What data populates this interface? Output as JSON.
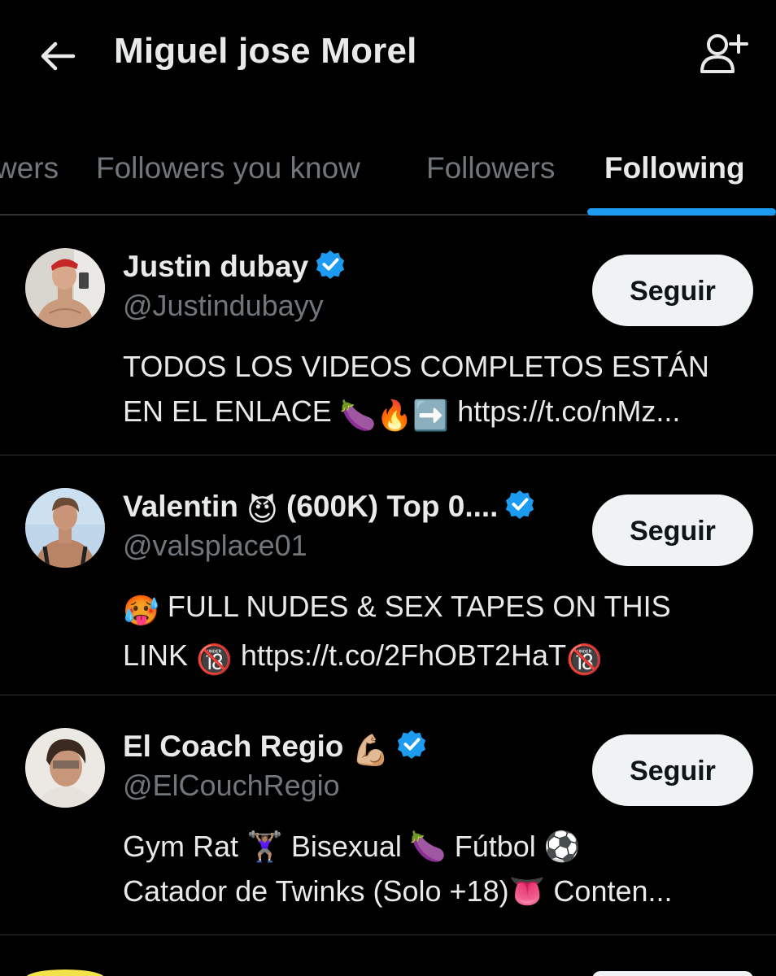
{
  "header": {
    "title": "Miguel jose Morel"
  },
  "tabs": [
    {
      "label": "wers"
    },
    {
      "label": "Followers you know"
    },
    {
      "label": "Followers"
    },
    {
      "label": "Following",
      "active": true
    }
  ],
  "accounts": [
    {
      "name": "Justin dubay",
      "handle": "@Justindubayy",
      "verified": true,
      "button": "Seguir",
      "bio_line1": "TODOS LOS VIDEOS COMPLETOS ESTÁN",
      "bio_line2_text": "EN EL ENLACE",
      "bio_line2_emoji": "🍆🔥➡️",
      "bio_line2_link": "https://t.co/nMz..."
    },
    {
      "name": "Valentin",
      "name_emoji": "😈",
      "name_rest": "(600K) Top 0....",
      "handle": "@valsplace01",
      "verified": true,
      "button": "Seguir",
      "bio_line1_emoji": "🥵",
      "bio_line1": "FULL NUDES & SEX TAPES ON THIS",
      "bio_line2_text": "LINK",
      "bio_line2_emoji": "🔞",
      "bio_line2_link": "https://t.co/2FhOBT2HaT",
      "bio_line2_emoji_end": "🔞"
    },
    {
      "name": "El Coach Regio",
      "name_emoji": "💪🏼",
      "handle": "@ElCouchRegio",
      "verified": true,
      "button": "Seguir",
      "bio_line1": "Gym Rat 🏋🏽‍♀️ Bisexual 🍆 Fútbol ⚽",
      "bio_line2": "Catador de Twinks (Solo +18)👅 Conten..."
    }
  ],
  "colors": {
    "background": "#000000",
    "accent": "#1d9bf0",
    "primary_text": "#e7e9ea",
    "secondary_text": "#71767b",
    "button_bg": "#eff3f4",
    "divider": "#2f3336"
  },
  "icons": [
    "back-arrow-icon",
    "add-person-icon",
    "verified-badge-icon"
  ]
}
